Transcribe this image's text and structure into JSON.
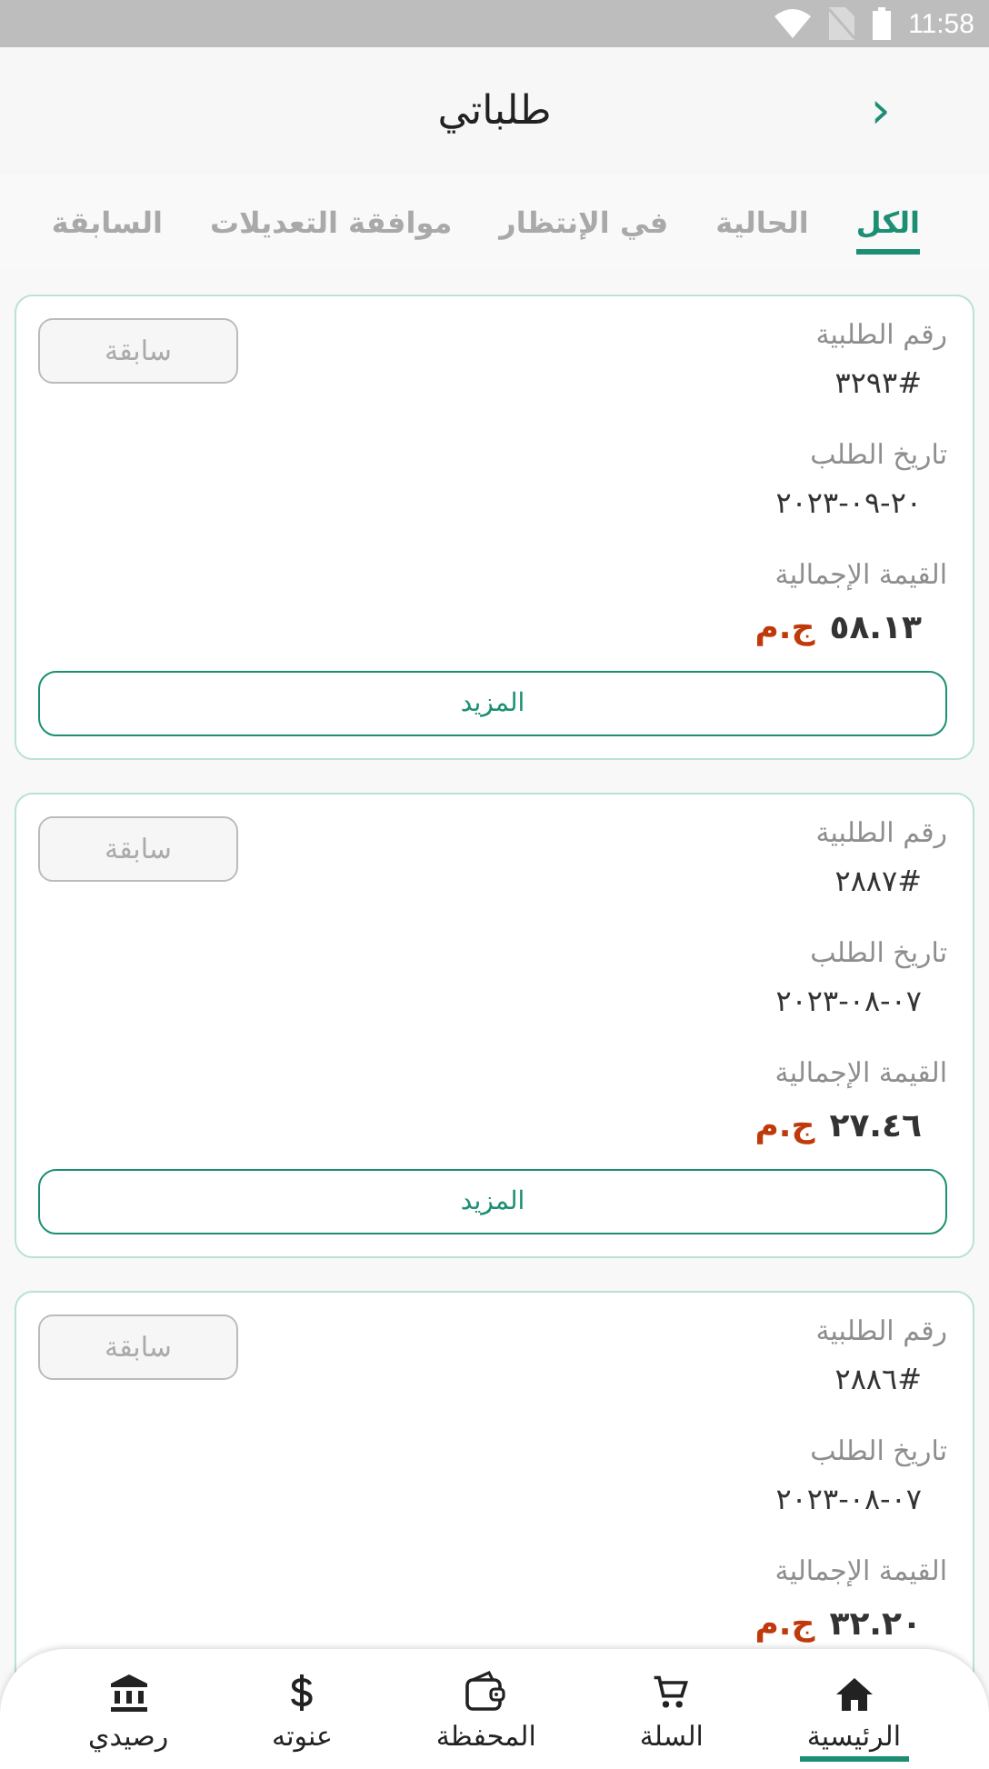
{
  "status_bar": {
    "time": "11:58"
  },
  "header": {
    "title": "طلباتي",
    "back": "›"
  },
  "tabs": [
    {
      "label": "الكل",
      "selected": true
    },
    {
      "label": "الحالية",
      "selected": false
    },
    {
      "label": "في الإنتظار",
      "selected": false
    },
    {
      "label": "موافقة التعديلات",
      "selected": false
    },
    {
      "label": "السابقة",
      "selected": false
    }
  ],
  "orders": [
    {
      "number_label": "رقم الطلبية",
      "number": "#٣٢٩٣",
      "date_label": "تاريخ الطلب",
      "date": "٢٠٢٣-٠٩-٢٠",
      "total_label": "القيمة الإجمالية",
      "total": "٥٨.١٣",
      "currency": "ج.م",
      "status": "سابقة",
      "more": "المزيد"
    },
    {
      "number_label": "رقم الطلبية",
      "number": "#٢٨٨٧",
      "date_label": "تاريخ الطلب",
      "date": "٢٠٢٣-٠٨-٠٧",
      "total_label": "القيمة الإجمالية",
      "total": "٢٧.٤٦",
      "currency": "ج.م",
      "status": "سابقة",
      "more": "المزيد"
    },
    {
      "number_label": "رقم الطلبية",
      "number": "#٢٨٨٦",
      "date_label": "تاريخ الطلب",
      "date": "٢٠٢٣-٠٨-٠٧",
      "total_label": "القيمة الإجمالية",
      "total": "٣٢.٢٠",
      "currency": "ج.م",
      "status": "سابقة"
    }
  ],
  "bottom_nav": [
    {
      "label": "الرئيسية",
      "kind": "home",
      "selected": true
    },
    {
      "label": "السلة",
      "kind": "cart",
      "selected": false
    },
    {
      "label": "المحفظة",
      "kind": "wallet",
      "selected": false
    },
    {
      "label": "عنوته",
      "kind": "dollar",
      "selected": false
    },
    {
      "label": "رصيدي",
      "kind": "bank",
      "selected": false
    }
  ]
}
